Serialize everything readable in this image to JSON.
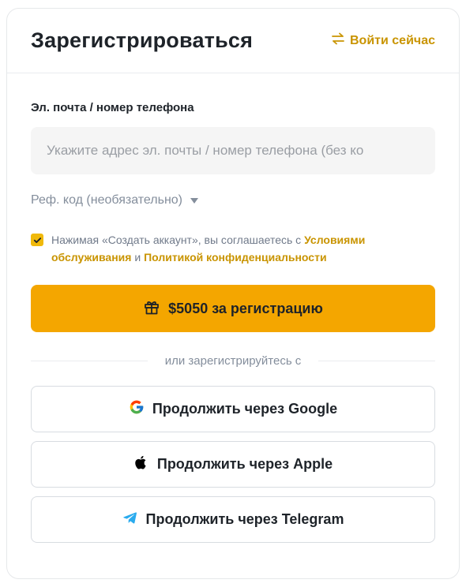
{
  "header": {
    "title": "Зарегистрироваться",
    "login_label": "Войти сейчас"
  },
  "form": {
    "email_label": "Эл. почта / номер телефона",
    "email_placeholder": "Укажите адрес эл. почты / номер телефона (без ко",
    "email_value": "",
    "referral_label": "Реф. код (необязательно)",
    "agree_checked": true,
    "agree_prefix": "Нажимая «Создать аккаунт», вы соглашаетесь с ",
    "terms_link": "Условиями обслуживания",
    "agree_and": " и ",
    "privacy_link": "Политикой конфиденциальности",
    "submit_label": "$5050 за регистрацию"
  },
  "divider_text": "или зарегистрируйтесь с",
  "social": [
    {
      "label": "Продолжить через Google",
      "icon": "google-icon"
    },
    {
      "label": "Продолжить через Apple",
      "icon": "apple-icon"
    },
    {
      "label": "Продолжить через Telegram",
      "icon": "telegram-icon"
    }
  ],
  "colors": {
    "accent": "#f4a600",
    "link": "#c99400",
    "checkbox": "#f0b90b",
    "telegram": "#2aabee"
  }
}
